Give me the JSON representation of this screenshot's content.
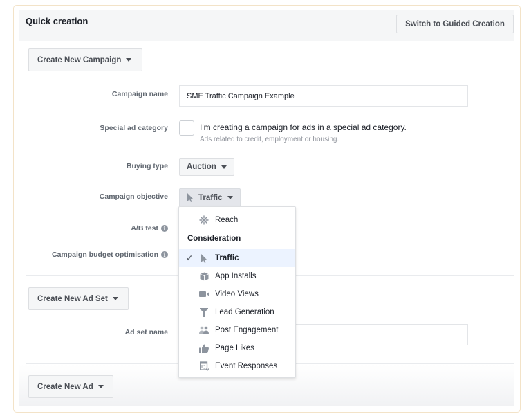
{
  "header": {
    "title": "Quick creation",
    "switch_button": "Switch to Guided Creation"
  },
  "campaign": {
    "create_button": "Create New Campaign",
    "name_label": "Campaign name",
    "name_value": "SME Traffic Campaign Example",
    "special_label": "Special ad category",
    "special_checkbox_checked": false,
    "special_text": "I'm creating a campaign for ads in a special ad category.",
    "special_subtext": "Ads related to credit, employment or housing.",
    "buying_type_label": "Buying type",
    "buying_type_value": "Auction",
    "objective_label": "Campaign objective",
    "objective_value": "Traffic",
    "ab_test_label": "A/B test",
    "cbo_label": "Campaign budget optimisation",
    "info_glyph": "i"
  },
  "objective_menu": {
    "items_top": [
      {
        "label": "Reach",
        "icon": "reach-icon"
      }
    ],
    "section_heading": "Consideration",
    "selected_check": "✓",
    "items": [
      {
        "label": "Traffic",
        "icon": "cursor-icon",
        "selected": true
      },
      {
        "label": "App Installs",
        "icon": "box-icon",
        "selected": false
      },
      {
        "label": "Video Views",
        "icon": "video-camera-icon",
        "selected": false
      },
      {
        "label": "Lead Generation",
        "icon": "funnel-icon",
        "selected": false
      },
      {
        "label": "Post Engagement",
        "icon": "people-icon",
        "selected": false
      },
      {
        "label": "Page Likes",
        "icon": "thumbs-up-icon",
        "selected": false
      },
      {
        "label": "Event Responses",
        "icon": "calendar-icon",
        "selected": false
      }
    ]
  },
  "adset": {
    "create_button": "Create New Ad Set",
    "name_label": "Ad set name",
    "name_value": ""
  },
  "ad": {
    "create_button": "Create New Ad"
  },
  "colors": {
    "selected_bg": "#ecf3ff",
    "outer_border": "#f3e3c8",
    "icon_gray": "#8d949e"
  }
}
